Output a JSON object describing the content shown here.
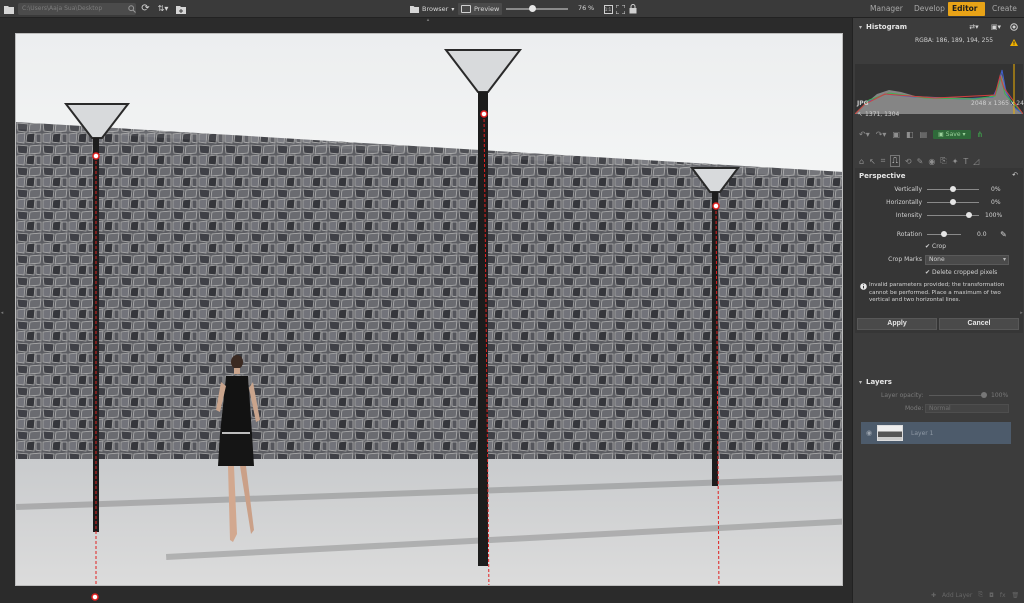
{
  "toolbar": {
    "path": "C:\\Users\\Aaja Sua\\Desktop",
    "browser_label": "Browser",
    "preview_label": "Preview",
    "zoom_value": "76",
    "zoom_unit": "%",
    "zoom_level": 0.42
  },
  "modes": [
    {
      "label": "Manager"
    },
    {
      "label": "Develop"
    },
    {
      "label": "Editor"
    },
    {
      "label": "Create"
    }
  ],
  "histogram": {
    "title": "Histogram",
    "rgba": "RGBA: 186, 189, 194, 255",
    "format": "JPG",
    "dimensions": "2048 x 1365 x 24",
    "cursor": "1371, 1304"
  },
  "action_bar": {
    "save_label": "Save"
  },
  "perspective": {
    "title": "Perspective",
    "vertically_label": "Vertically",
    "vertically_value": "0%",
    "vertically_level": 0.5,
    "horizontally_label": "Horizontally",
    "horizontally_value": "0%",
    "horizontally_level": 0.5,
    "intensity_label": "Intensity",
    "intensity_value": "100%",
    "intensity_level": 0.8,
    "rotation_label": "Rotation",
    "rotation_value": "0.0",
    "rotation_level": 0.5,
    "crop_label": "Crop",
    "crop_marks_label": "Crop Marks",
    "crop_marks_value": "None",
    "delete_cropped_label": "Delete cropped pixels",
    "warning": "Invalid parameters provided; the transformation cannot be performed. Place a maximum of two vertical and two horizontal lines.",
    "apply_label": "Apply",
    "cancel_label": "Cancel"
  },
  "layers": {
    "title": "Layers",
    "opacity_label": "Layer opacity:",
    "opacity_value": "100%",
    "mode_label": "Mode:",
    "mode_value": "Normal",
    "layer_name": "Layer 1",
    "add_layer_label": "Add Layer"
  },
  "colors": {
    "accent": "#e8a317",
    "guide": "#e02020",
    "panel_bg": "#3c3c3c"
  }
}
